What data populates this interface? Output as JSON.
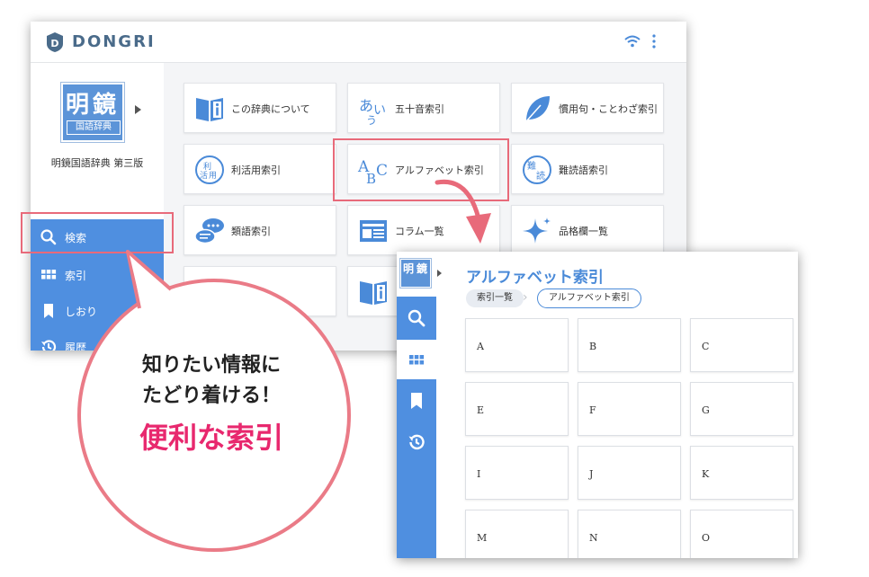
{
  "back_window": {
    "brand": "DONGRI",
    "dictionary": {
      "cover_kanji_1": "明",
      "cover_kanji_2": "鏡",
      "cover_sub": "国語辞典",
      "title": "明鏡国語辞典 第三版"
    },
    "nav": [
      {
        "label": "検索",
        "icon": "search-icon"
      },
      {
        "label": "索引",
        "icon": "grid-icon"
      },
      {
        "label": "しおり",
        "icon": "bookmark-icon"
      },
      {
        "label": "履歴",
        "icon": "history-icon"
      }
    ],
    "index_cards": [
      {
        "label": "この辞典について",
        "icon": "info-book-icon"
      },
      {
        "label": "五十音索引",
        "icon": "aiu-icon",
        "icon_text": "あい う"
      },
      {
        "label": "慣用句・ことわざ索引",
        "icon": "leaf-icon"
      },
      {
        "label": "利活用索引",
        "icon": "rikatsuyou-icon",
        "icon_text": "利活用"
      },
      {
        "label": "アルファベット索引",
        "icon": "abc-icon",
        "icon_text": "ABC"
      },
      {
        "label": "難読語索引",
        "icon": "nandoku-icon",
        "icon_text": "難読"
      },
      {
        "label": "類語索引",
        "icon": "chat-icon"
      },
      {
        "label": "コラム一覧",
        "icon": "column-icon"
      },
      {
        "label": "品格欄一覧",
        "icon": "sparkle-icon"
      }
    ]
  },
  "bubble": {
    "line1": "知りたい情報に",
    "line2": "たどり着ける！",
    "line3": "便利な索引"
  },
  "front_window": {
    "title": "アルファベット索引",
    "breadcrumb": [
      "索引一覧",
      "アルファベット索引"
    ],
    "letters": [
      "A",
      "B",
      "C",
      "E",
      "F",
      "G",
      "I",
      "J",
      "K",
      "M",
      "N",
      "O"
    ]
  },
  "colors": {
    "accent_blue": "#4f8fe0",
    "highlight_red": "#e86a7a",
    "pink_text": "#e8286e"
  }
}
